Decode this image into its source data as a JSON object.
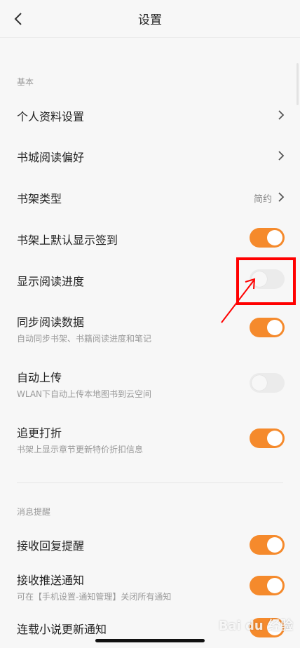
{
  "header": {
    "title": "设置",
    "back_icon": "chevron-left-icon"
  },
  "sections": {
    "basic": {
      "label": "基本"
    },
    "notifications": {
      "label": "消息提醒"
    }
  },
  "rows": {
    "profile": {
      "label": "个人资料设置"
    },
    "store_prefs": {
      "label": "书城阅读偏好"
    },
    "shelf_type": {
      "label": "书架类型",
      "value": "简约"
    },
    "shelf_checkin": {
      "label": "书架上默认显示签到",
      "enabled": true
    },
    "show_progress": {
      "label": "显示阅读进度",
      "enabled": false
    },
    "sync_data": {
      "label": "同步阅读数据",
      "sub": "自动同步书架、书籍阅读进度和笔记",
      "enabled": true
    },
    "auto_upload": {
      "label": "自动上传",
      "sub": "WLAN下自动上传本地图书到云空间",
      "enabled": false
    },
    "discount": {
      "label": "追更打折",
      "sub": "书架上显示章节更新特价折扣信息",
      "enabled": true
    },
    "reply_reminder": {
      "label": "接收回复提醒",
      "enabled": true
    },
    "push_notify": {
      "label": "接收推送通知",
      "sub": "可在【手机设置-通知管理】关闭所有通知",
      "enabled": true
    },
    "serial_update": {
      "label": "连载小说更新通知",
      "enabled": true
    }
  },
  "colors": {
    "accent": "#f58a2c",
    "annotation": "#ff0000"
  },
  "watermark": {
    "text": "Bai du 经验"
  }
}
